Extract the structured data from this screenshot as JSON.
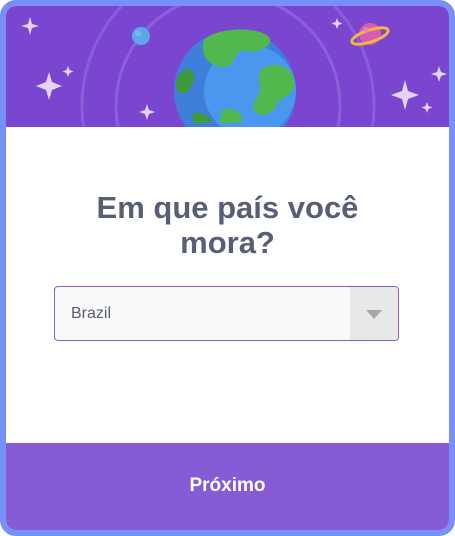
{
  "dialog": {
    "question": "Em que país você mora?",
    "country_select": {
      "selected_value": "Brazil"
    },
    "next_button_label": "Próximo"
  },
  "header": {
    "illustration": [
      "globe-icon",
      "planet-icon",
      "moon-icon",
      "sparkle-icon"
    ]
  },
  "colors": {
    "frame_border": "#7690f8",
    "header_background": "#7b46cf",
    "button_background": "#855cd6",
    "question_text": "#575e75",
    "select_border": "#8a5cd0"
  }
}
